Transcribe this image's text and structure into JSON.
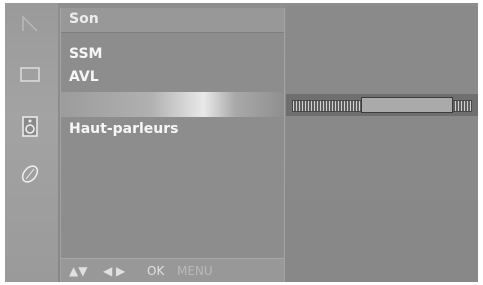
{
  "sidebar": {
    "icons": [
      {
        "name": "channel-icon"
      },
      {
        "name": "picture-icon"
      },
      {
        "name": "sound-icon"
      },
      {
        "name": "setup-icon"
      }
    ],
    "selected_index": 2
  },
  "menu": {
    "title": "Son",
    "items": [
      {
        "label": "SSM"
      },
      {
        "label": "AVL"
      },
      {
        "label": ""
      },
      {
        "label": "Haut-parleurs"
      }
    ],
    "selected_index": 2
  },
  "nav": {
    "arrows_updown": "▲▼",
    "arrows_leftright": "◀ ▶",
    "ok": "OK",
    "menu": "MENU"
  },
  "slider": {
    "level_fraction": 0.39
  },
  "colors": {
    "text": "#f6f6f6",
    "panel": "#8d8d8d",
    "highlight": "#e9e9e9"
  }
}
